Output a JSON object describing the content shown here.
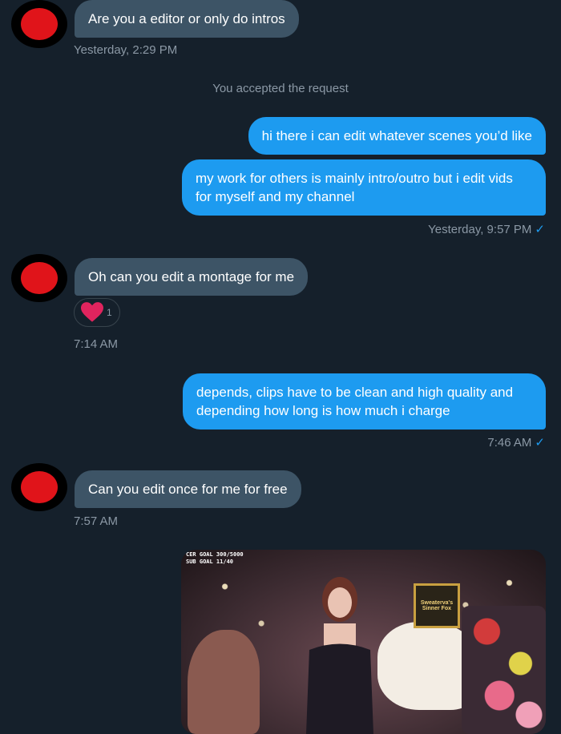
{
  "messages": [
    {
      "id": "m1",
      "dir": "in",
      "text": "Are you a editor or only do intros",
      "time": "Yesterday, 2:29 PM"
    },
    {
      "id": "sys",
      "text": "You accepted the request"
    },
    {
      "id": "m2",
      "dir": "out",
      "text": "hi there i can edit whatever scenes you’d like"
    },
    {
      "id": "m3",
      "dir": "out",
      "text": "my work for others is mainly intro/outro but i edit vids for myself and my channel",
      "time": "Yesterday, 9:57 PM"
    },
    {
      "id": "m4",
      "dir": "in",
      "text": "Oh can you edit a montage for me",
      "reaction_count": "1",
      "time": "7:14 AM"
    },
    {
      "id": "m5",
      "dir": "out",
      "text": "depends, clips have to be clean and high quality and depending how long is how much i charge",
      "time": "7:46 AM"
    },
    {
      "id": "m6",
      "dir": "in",
      "text": "Can you edit once for me for free",
      "time": "7:57 AM"
    }
  ],
  "read_check": "✓",
  "media": {
    "overlay_line1": "CER GOAL 300/5000",
    "overlay_line2": "SUB GOAL 11/40",
    "sign_text": "Sweaterva's Sinner Fox"
  },
  "colors": {
    "incoming": "#3d5466",
    "outgoing": "#1d9bf0",
    "background": "#15202b",
    "avatar": "#e0141a"
  }
}
